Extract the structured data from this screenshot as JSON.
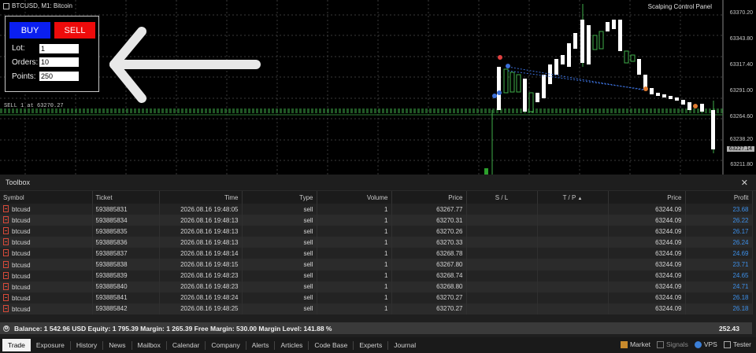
{
  "chart": {
    "header": "BTCUSD, M1:  Bitcoin",
    "panel_title": "Scalping Control Panel",
    "sell_line_label": "SELL 1 at 63270.27",
    "price_scale": [
      "63370.20",
      "63343.80",
      "63317.40",
      "63291.00",
      "63264.60",
      "63238.20",
      "63211.80"
    ],
    "current_price": "63227.14"
  },
  "control_panel": {
    "buy_label": "BUY",
    "sell_label": "SELL",
    "lot_label": "Lot:",
    "lot_value": "1",
    "orders_label": "Orders:",
    "orders_value": "10",
    "points_label": "Points:",
    "points_value": "250",
    "buy_color": "#0a1ff0",
    "sell_color": "#ee0b0b"
  },
  "toolbox": {
    "title": "Toolbox",
    "close_icon": "close-icon",
    "columns": {
      "symbol": "Symbol",
      "ticket": "Ticket",
      "time": "Time",
      "type": "Type",
      "volume": "Volume",
      "price": "Price",
      "sl": "S / L",
      "tp": "T / P",
      "sort_indicator": "▲",
      "cur_price": "Price",
      "profit": "Profit"
    },
    "rows": [
      {
        "symbol": "btcusd",
        "ticket": "593885831",
        "time": "2026.08.16 19:48:05",
        "type": "sell",
        "volume": "1",
        "price": "63267.77",
        "sl": "",
        "tp": "",
        "cur_price": "63244.09",
        "profit": "23.68"
      },
      {
        "symbol": "btcusd",
        "ticket": "593885834",
        "time": "2026.08.16 19:48:13",
        "type": "sell",
        "volume": "1",
        "price": "63270.31",
        "sl": "",
        "tp": "",
        "cur_price": "63244.09",
        "profit": "26.22"
      },
      {
        "symbol": "btcusd",
        "ticket": "593885835",
        "time": "2026.08.16 19:48:13",
        "type": "sell",
        "volume": "1",
        "price": "63270.26",
        "sl": "",
        "tp": "",
        "cur_price": "63244.09",
        "profit": "26.17"
      },
      {
        "symbol": "btcusd",
        "ticket": "593885836",
        "time": "2026.08.16 19:48:13",
        "type": "sell",
        "volume": "1",
        "price": "63270.33",
        "sl": "",
        "tp": "",
        "cur_price": "63244.09",
        "profit": "26.24"
      },
      {
        "symbol": "btcusd",
        "ticket": "593885837",
        "time": "2026.08.16 19:48:14",
        "type": "sell",
        "volume": "1",
        "price": "63268.78",
        "sl": "",
        "tp": "",
        "cur_price": "63244.09",
        "profit": "24.69"
      },
      {
        "symbol": "btcusd",
        "ticket": "593885838",
        "time": "2026.08.16 19:48:15",
        "type": "sell",
        "volume": "1",
        "price": "63267.80",
        "sl": "",
        "tp": "",
        "cur_price": "63244.09",
        "profit": "23.71"
      },
      {
        "symbol": "btcusd",
        "ticket": "593885839",
        "time": "2026.08.16 19:48:23",
        "type": "sell",
        "volume": "1",
        "price": "63268.74",
        "sl": "",
        "tp": "",
        "cur_price": "63244.09",
        "profit": "24.65"
      },
      {
        "symbol": "btcusd",
        "ticket": "593885840",
        "time": "2026.08.16 19:48:23",
        "type": "sell",
        "volume": "1",
        "price": "63268.80",
        "sl": "",
        "tp": "",
        "cur_price": "63244.09",
        "profit": "24.71"
      },
      {
        "symbol": "btcusd",
        "ticket": "593885841",
        "time": "2026.08.16 19:48:24",
        "type": "sell",
        "volume": "1",
        "price": "63270.27",
        "sl": "",
        "tp": "",
        "cur_price": "63244.09",
        "profit": "26.18"
      },
      {
        "symbol": "btcusd",
        "ticket": "593885842",
        "time": "2026.08.16 19:48:25",
        "type": "sell",
        "volume": "1",
        "price": "63270.27",
        "sl": "",
        "tp": "",
        "cur_price": "63244.09",
        "profit": "26.18"
      }
    ],
    "balance_text": "Balance: 1 542.96 USD  Equity: 1 795.39  Margin: 1 265.39  Free Margin: 530.00  Margin Level: 141.88 %",
    "balance_total": "252.43",
    "tabs": [
      "Trade",
      "Exposure",
      "History",
      "News",
      "Mailbox",
      "Calendar",
      "Company",
      "Alerts",
      "Articles",
      "Code Base",
      "Experts",
      "Journal"
    ],
    "right_items": {
      "market": "Market",
      "signals": "Signals",
      "vps": "VPS",
      "tester": "Tester"
    }
  }
}
